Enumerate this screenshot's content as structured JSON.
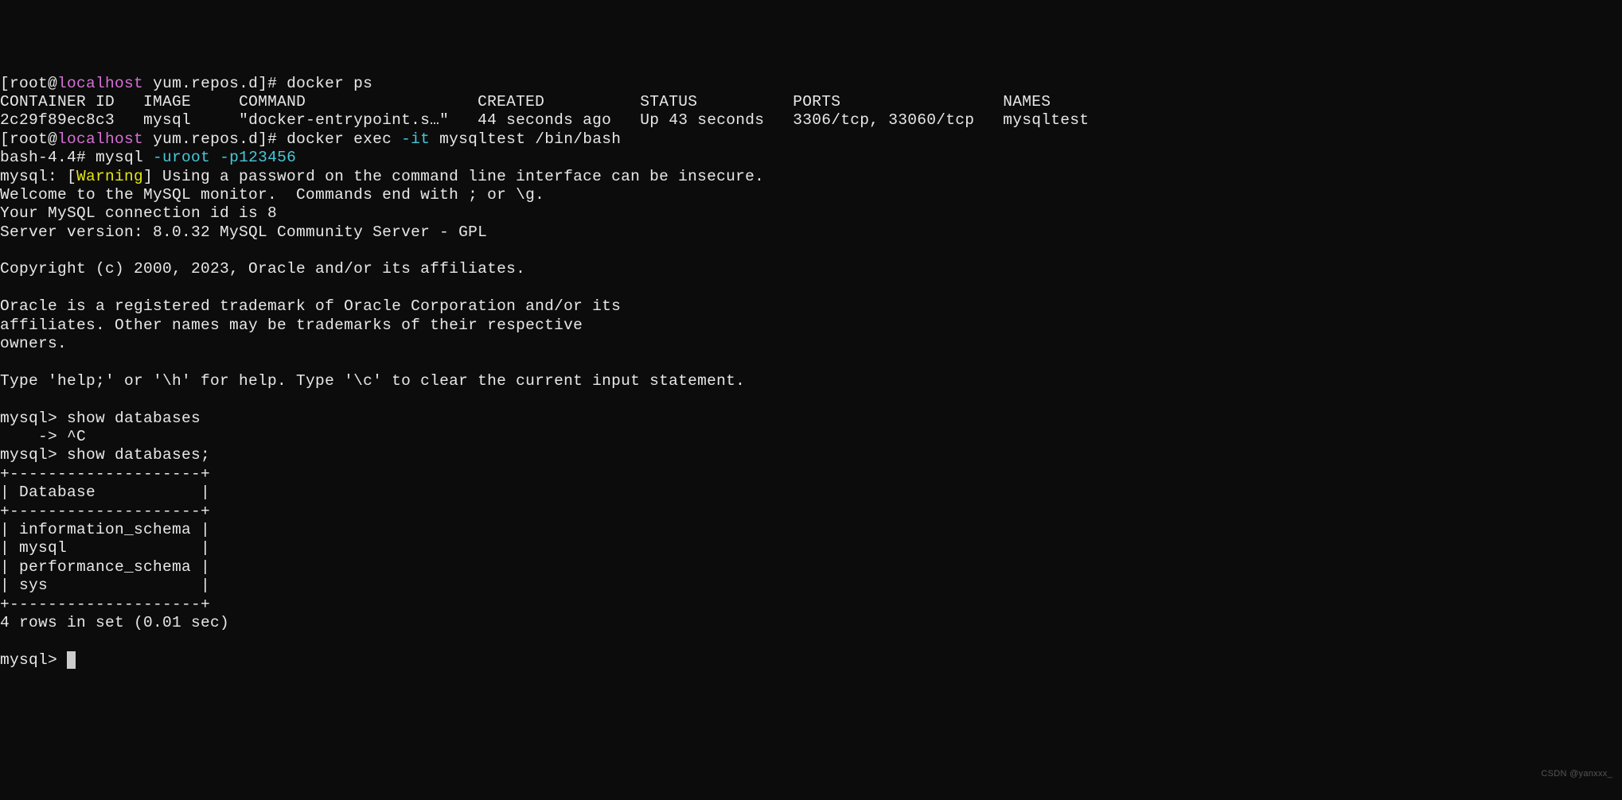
{
  "prompt1": {
    "bracket_open": "[",
    "user": "root",
    "at": "@",
    "host": "localhost",
    "path": " yum.repos.d",
    "bracket_close": "]# ",
    "command": "docker ps"
  },
  "docker_ps": {
    "headers": {
      "container_id": "CONTAINER ID",
      "image": "IMAGE",
      "command": "COMMAND",
      "created": "CREATED",
      "status": "STATUS",
      "ports": "PORTS",
      "names": "NAMES"
    },
    "row": {
      "container_id": "2c29f89ec8c3",
      "image": "mysql",
      "command": "\"docker-entrypoint.s…\"",
      "created": "44 seconds ago",
      "status": "Up 43 seconds",
      "ports": "3306/tcp, 33060/tcp",
      "names": "mysqltest"
    }
  },
  "prompt2": {
    "bracket_open": "[",
    "user": "root",
    "at": "@",
    "host": "localhost",
    "path": " yum.repos.d",
    "bracket_close": "]# ",
    "cmd_part1": "docker exec ",
    "cmd_flag": "-it",
    "cmd_part2": " mysqltest /bin/bash"
  },
  "bash_prompt": {
    "prompt": "bash-4.4# ",
    "cmd": "mysql ",
    "flag1": "-uroot",
    "space": " ",
    "flag2": "-p123456"
  },
  "mysql_warning": {
    "prefix": "mysql: [",
    "warning": "Warning",
    "suffix": "] Using a password on the command line interface can be insecure."
  },
  "welcome": {
    "line1": "Welcome to the MySQL monitor.  Commands end with ; or \\g.",
    "line2": "Your MySQL connection id is 8",
    "line3": "Server version: 8.0.32 MySQL Community Server - GPL",
    "blank1": "",
    "line4": "Copyright (c) 2000, 2023, Oracle and/or its affiliates.",
    "blank2": "",
    "line5": "Oracle is a registered trademark of Oracle Corporation and/or its",
    "line6": "affiliates. Other names may be trademarks of their respective",
    "line7": "owners.",
    "blank3": "",
    "line8": "Type 'help;' or '\\h' for help. Type '\\c' to clear the current input statement.",
    "blank4": ""
  },
  "mysql_session": {
    "prompt1": "mysql> show databases",
    "continuation": "    -> ^C",
    "prompt2": "mysql> show databases;",
    "table_border": "+--------------------+",
    "table_header": "| Database           |",
    "row1": "| information_schema |",
    "row2": "| mysql              |",
    "row3": "| performance_schema |",
    "row4": "| sys                |",
    "result": "4 rows in set (0.01 sec)",
    "blank": "",
    "prompt3": "mysql> "
  },
  "watermark": "CSDN @yanxxx_"
}
